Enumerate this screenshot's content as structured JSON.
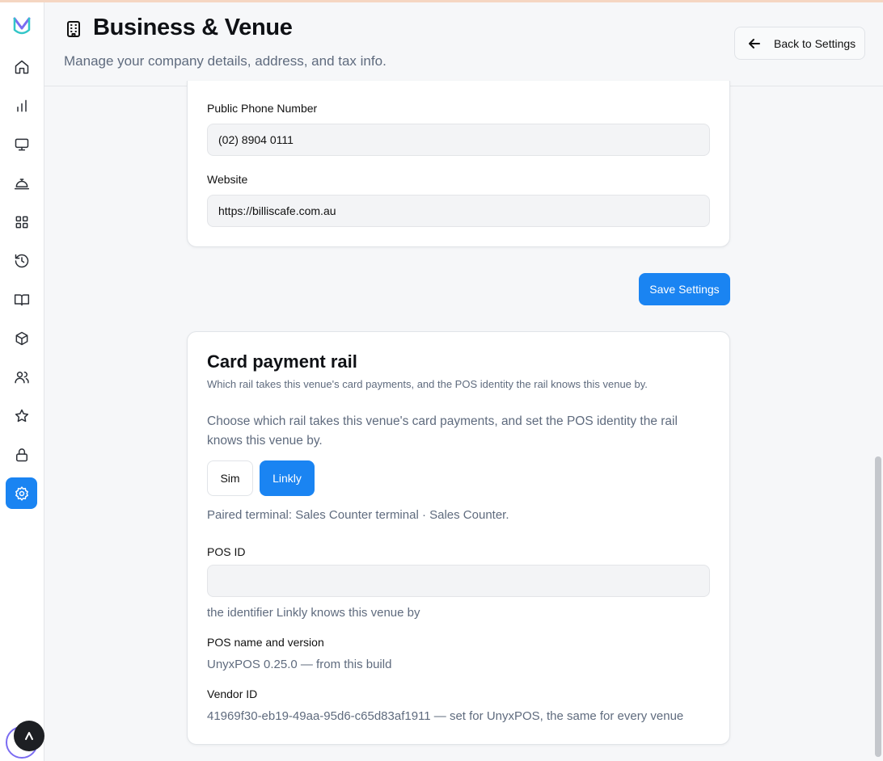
{
  "header": {
    "title": "Business & Venue",
    "subtitle": "Manage your company details, address, and tax info.",
    "back_label": "Back to Settings"
  },
  "sidebar": {
    "items": [
      {
        "icon": "home-icon"
      },
      {
        "icon": "bar-chart-icon"
      },
      {
        "icon": "monitor-icon"
      },
      {
        "icon": "service-bell-icon"
      },
      {
        "icon": "grid-icon"
      },
      {
        "icon": "history-icon"
      },
      {
        "icon": "book-icon"
      },
      {
        "icon": "box-icon"
      },
      {
        "icon": "users-icon"
      },
      {
        "icon": "star-icon"
      },
      {
        "icon": "lock-icon"
      },
      {
        "icon": "gear-icon",
        "active": true
      }
    ]
  },
  "contact": {
    "phone_label": "Public Phone Number",
    "phone_value": "(02) 8904 0111",
    "website_label": "Website",
    "website_value": "https://billiscafe.com.au"
  },
  "save_label": "Save Settings",
  "payment_rail": {
    "title": "Card payment rail",
    "subtitle": "Which rail takes this venue's card payments, and the POS identity the rail knows this venue by.",
    "description": "Choose which rail takes this venue's card payments, and set the POS identity the rail knows this venue by.",
    "options": [
      "Sim",
      "Linkly"
    ],
    "selected": "Linkly",
    "paired_terminal": "Paired terminal: Sales Counter terminal · Sales Counter.",
    "pos_id_label": "POS ID",
    "pos_id_value": "",
    "pos_id_help": "the identifier Linkly knows this venue by",
    "pos_name_label": "POS name and version",
    "pos_name_value": "UnyxPOS 0.25.0 — from this build",
    "vendor_id_label": "Vendor ID",
    "vendor_id_value": "41969f30-eb19-49aa-95d6-c65d83af1911 — set for UnyxPOS, the same for every venue"
  },
  "colors": {
    "accent": "#1a84f2",
    "muted_text": "#5f6b7e",
    "input_bg": "#f3f4f6"
  }
}
